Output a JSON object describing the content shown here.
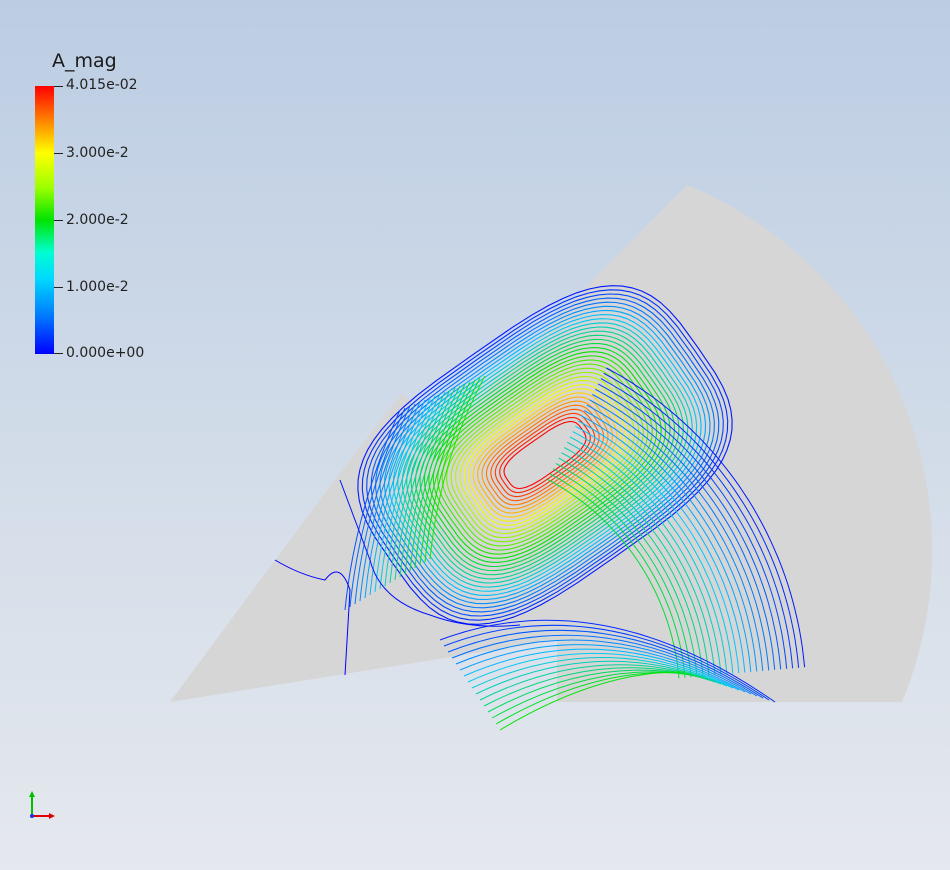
{
  "scalar_bar": {
    "title": "A_mag",
    "labels": [
      "4.015e-02",
      "3.000e-2",
      "2.000e-2",
      "1.000e-2",
      "0.000e+00"
    ]
  },
  "colors": {
    "background_top": "#bccde3",
    "background_bottom": "#e5e8ee",
    "domain_fill": "#d6d6d6",
    "colormap": [
      "#0000ff",
      "#00c8ff",
      "#00e400",
      "#ffff00",
      "#ff0000"
    ]
  },
  "icons": {
    "orientation_axes": "xyz-axes-icon"
  }
}
